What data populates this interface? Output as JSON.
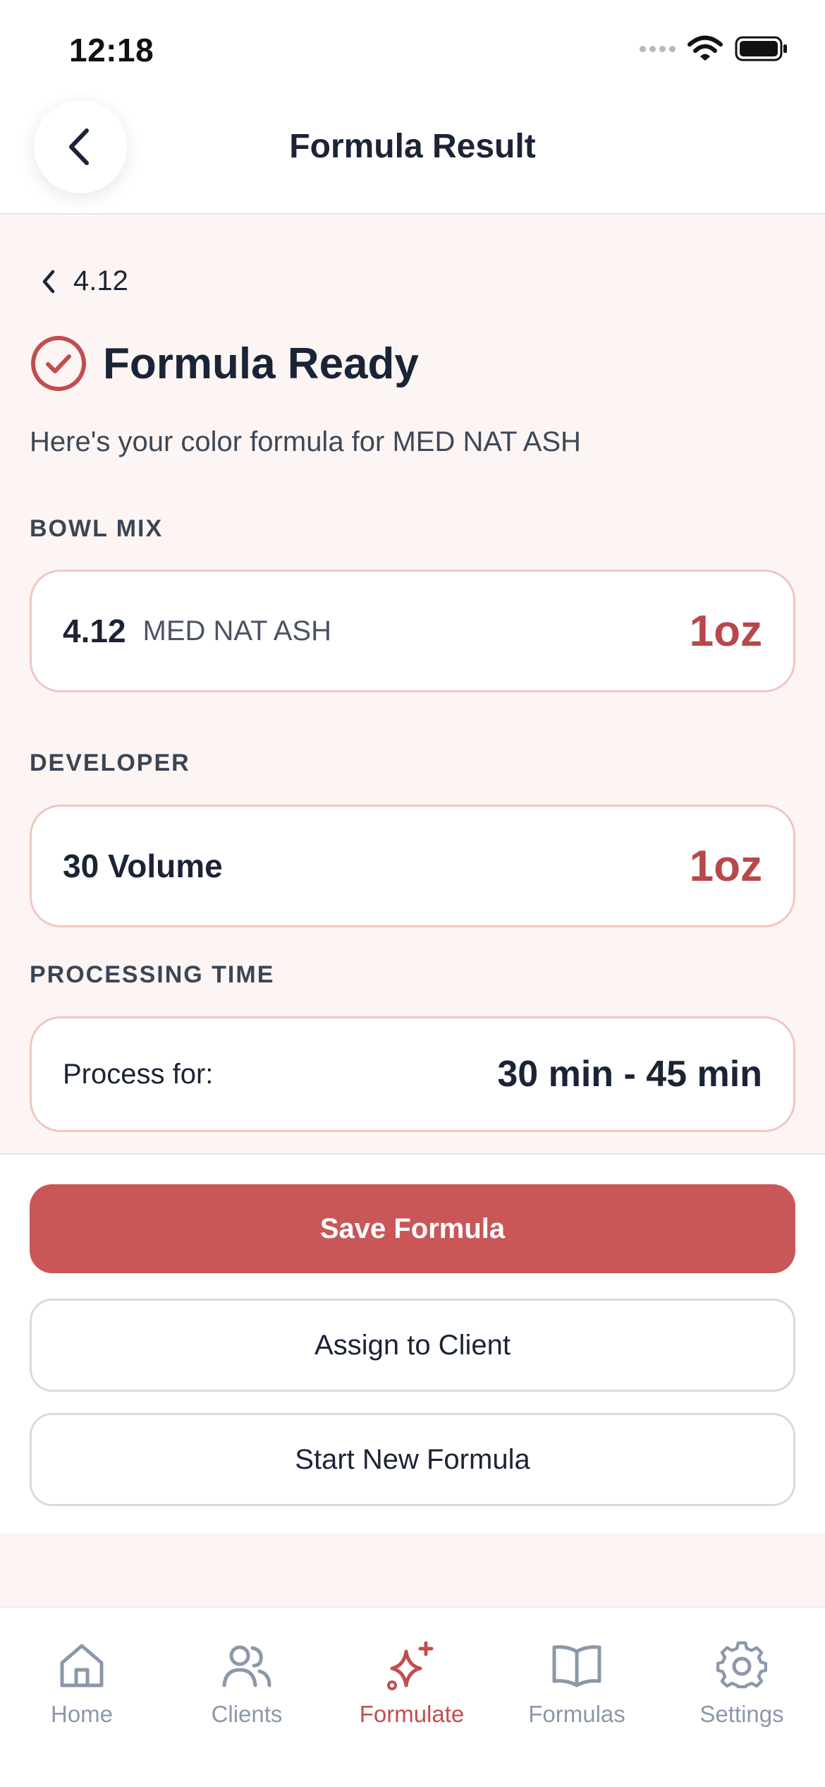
{
  "status_bar": {
    "time": "12:18"
  },
  "header": {
    "title": "Formula Result"
  },
  "breadcrumb": {
    "label": "4.12"
  },
  "result": {
    "title": "Formula Ready",
    "subtitle": "Here's your color formula for MED NAT ASH"
  },
  "bowl_mix": {
    "section_label": "BOWL MIX",
    "shade_code": "4.12",
    "shade_name": "MED NAT ASH",
    "amount": "1oz"
  },
  "developer": {
    "section_label": "DEVELOPER",
    "name": "30 Volume",
    "amount": "1oz"
  },
  "processing": {
    "section_label": "PROCESSING TIME",
    "label": "Process for:",
    "value": "30 min - 45 min"
  },
  "actions": {
    "save": "Save Formula",
    "assign": "Assign to Client",
    "new": "Start New Formula"
  },
  "tabs": [
    {
      "label": "Home",
      "icon": "home-icon"
    },
    {
      "label": "Clients",
      "icon": "users-icon"
    },
    {
      "label": "Formulate",
      "icon": "sparkles-icon",
      "active": true
    },
    {
      "label": "Formulas",
      "icon": "book-icon"
    },
    {
      "label": "Settings",
      "icon": "gear-icon"
    }
  ],
  "colors": {
    "accent": "#c95758",
    "amount": "#b8484a",
    "card_border": "#f2c6c0",
    "content_bg": "#fdf5f4",
    "tab_inactive": "#8b98ab"
  }
}
